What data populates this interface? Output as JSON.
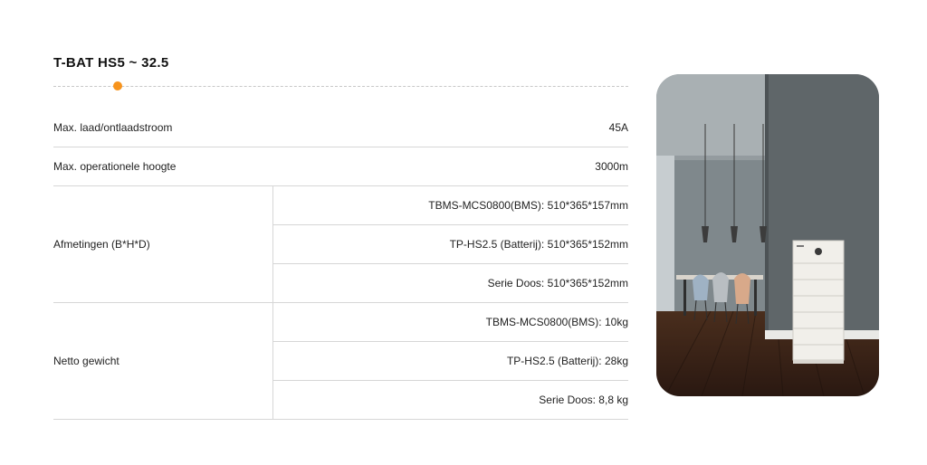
{
  "title": "T-BAT HS5 ~ 32.5",
  "accent_color": "#f7941d",
  "specs": {
    "max_current": {
      "label": "Max. laad/ontlaadstroom",
      "value": "45A"
    },
    "max_height": {
      "label": "Max. operationele hoogte",
      "value": "3000m"
    },
    "dimensions": {
      "label": "Afmetingen (B*H*D)",
      "values": [
        "TBMS-MCS0800(BMS): 510*365*157mm",
        "TP-HS2.5 (Batterij): 510*365*152mm",
        "Serie Doos: 510*365*152mm"
      ]
    },
    "net_weight": {
      "label": "Netto gewicht",
      "values": [
        "TBMS-MCS0800(BMS): 10kg",
        "TP-HS2.5 (Batterij): 28kg",
        "Serie Doos: 8,8 kg"
      ]
    }
  },
  "image": {
    "subject": "dining-room-with-battery-stack"
  }
}
